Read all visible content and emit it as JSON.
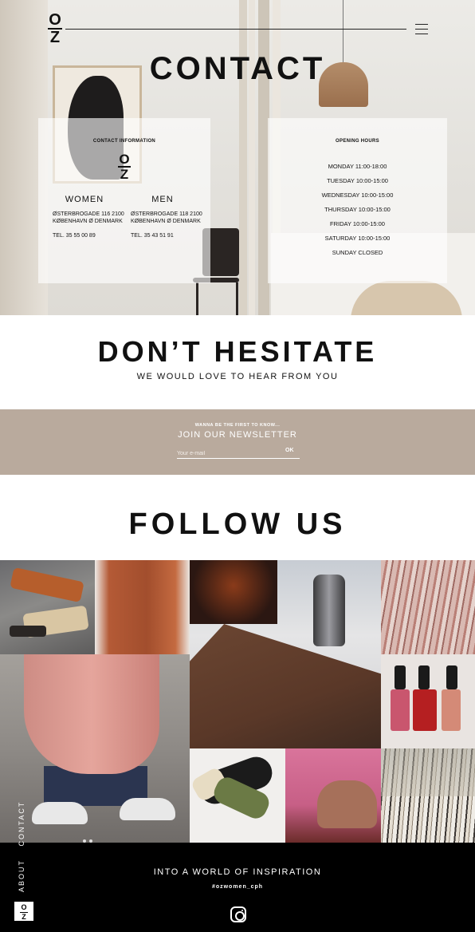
{
  "brand": {
    "logo_top": "O",
    "logo_bottom": "Z"
  },
  "hero": {
    "title": "CONTACT",
    "contact_info": {
      "title": "CONTACT INFORMATION",
      "women": {
        "heading": "WOMEN",
        "address": "ØSTERBROGADE 116 2100 KØBENHAVN Ø DENMARK",
        "tel": "TEL. 35 55 00 89"
      },
      "men": {
        "heading": "MEN",
        "address": "ØSTERBROGADE 118 2100 KØBENHAVN Ø DENMARK",
        "tel": "TEL. 35 43 51 91"
      }
    },
    "opening_hours": {
      "title": "OPENING HOURS",
      "days": [
        "MONDAY 11:00-18:00",
        "TUESDAY 10:00-15:00",
        "WEDNESDAY 10:00-15:00",
        "THURSDAY 10:00-15:00",
        "FRIDAY 10:00-15:00",
        "SATURDAY 10:00-15:00",
        "SUNDAY CLOSED"
      ]
    }
  },
  "hesitate": {
    "title": "DON’T HESITATE",
    "subtitle": "WE WOULD LOVE TO HEAR FROM YOU"
  },
  "newsletter": {
    "kicker": "WANNA BE THE FIRST TO KNOW...",
    "title": "JOIN OUR NEWSLETTER",
    "placeholder": "Your e-mail",
    "submit": "OK",
    "bg_color": "#b9aa9d"
  },
  "follow": {
    "title": "FOLLOW US"
  },
  "side_nav": {
    "items": [
      "ABOUT",
      "CONTACT"
    ]
  },
  "footer": {
    "title": "INTO A WORLD OF INSPIRATION",
    "hashtag": "#ozwomen_cph",
    "icon": "instagram-icon"
  }
}
